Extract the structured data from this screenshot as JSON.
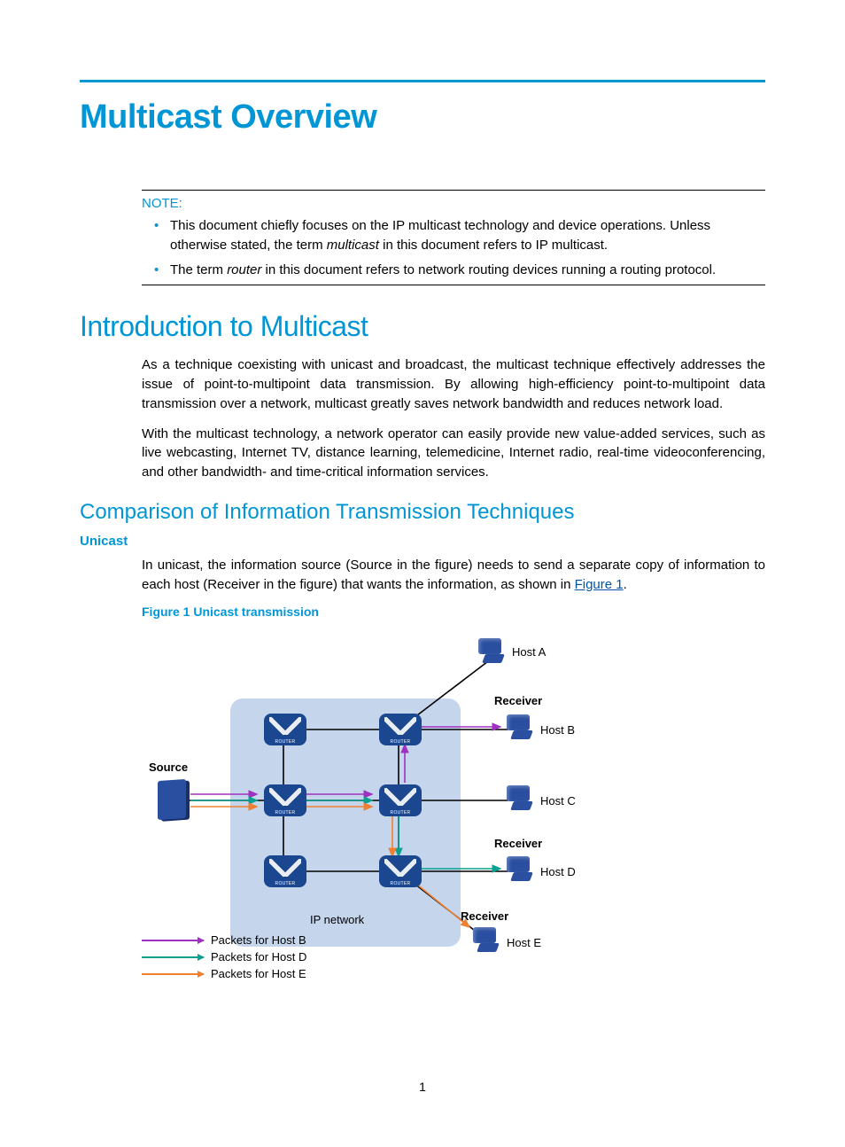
{
  "title": "Multicast Overview",
  "note": {
    "label": "NOTE:",
    "items": [
      "This document chiefly focuses on the IP multicast technology and device operations. Unless otherwise stated, the term <em>multicast</em> in this document refers to IP multicast.",
      "The term <em>router</em> in this document refers to network routing devices running a routing protocol."
    ]
  },
  "sections": {
    "intro": {
      "heading": "Introduction to Multicast",
      "p1": "As a technique coexisting with unicast and broadcast, the multicast technique effectively addresses the issue of point-to-multipoint data transmission. By allowing high-efficiency point-to-multipoint data transmission over a network, multicast greatly saves network bandwidth and reduces network load.",
      "p2": "With the multicast technology, a network operator can easily provide new value-added services, such as live webcasting, Internet TV, distance learning, telemedicine, Internet radio, real-time videoconferencing, and other bandwidth- and time-critical information services."
    },
    "compare": {
      "heading": "Comparison of Information Transmission Techniques",
      "unicast": {
        "heading": "Unicast",
        "p_pre": "In unicast, the information source (Source in the figure) needs to send a separate copy of information to each host (Receiver in the figure) that wants the information, as shown in ",
        "link": "Figure 1",
        "p_post": ".",
        "figcap": "Figure 1 Unicast transmission"
      }
    }
  },
  "diagram": {
    "ip_label": "IP network",
    "source_label": "Source",
    "receiver_label": "Receiver",
    "hosts": {
      "a": "Host A",
      "b": "Host B",
      "c": "Host C",
      "d": "Host D",
      "e": "Host E"
    },
    "legend": {
      "b": "Packets for Host B",
      "d": "Packets for Host D",
      "e": "Packets for Host E"
    }
  },
  "page_number": "1"
}
